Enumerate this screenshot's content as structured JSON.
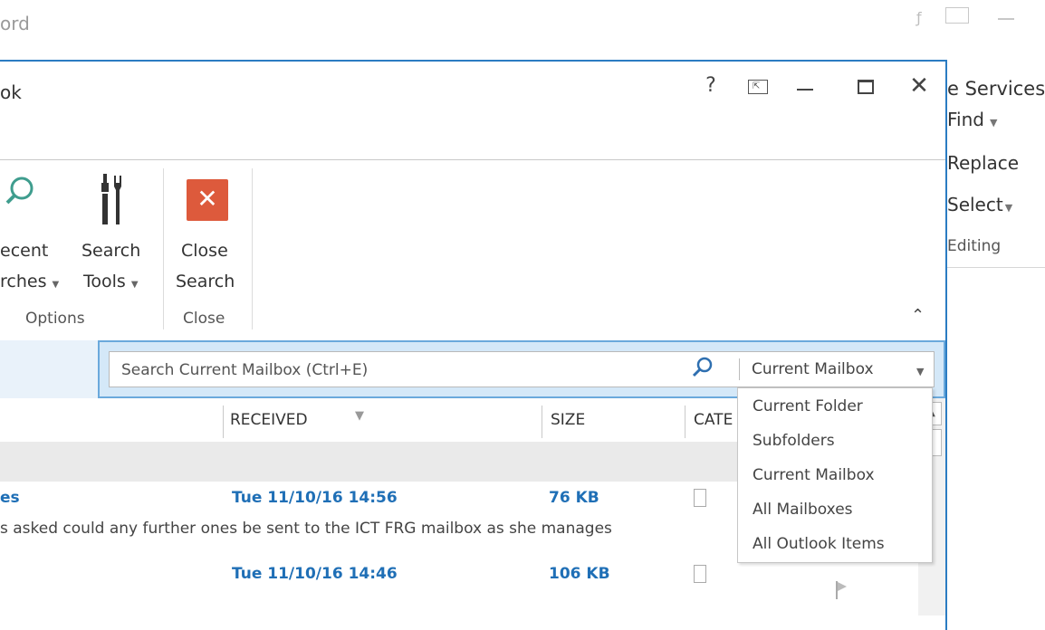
{
  "background_window": {
    "title_fragment": "ord",
    "services_fragment": "e Services",
    "editing": {
      "find": "Find",
      "replace": "Replace",
      "select": "Select",
      "group_label": "Editing"
    }
  },
  "window": {
    "title_fragment": "ok",
    "help_label": "?",
    "close_label": "✕"
  },
  "ribbon": {
    "recent_searches": {
      "line1": "ecent",
      "line2": "rches"
    },
    "search_tools": {
      "line1": "Search",
      "line2": "Tools"
    },
    "close_search": {
      "line1": "Close",
      "line2": "Search"
    },
    "groups": {
      "options": "Options",
      "close": "Close"
    }
  },
  "search": {
    "placeholder": "Search Current Mailbox (Ctrl+E)",
    "scope_selected": "Current Mailbox"
  },
  "columns": {
    "received": "RECEIVED",
    "size": "SIZE",
    "categories": "CATE"
  },
  "messages": [
    {
      "subject_fragment": "es",
      "received": "Tue 11/10/16 14:56",
      "size": "76 KB",
      "preview": "s asked could any further ones be sent to the ICT FRG mailbox as she manages"
    },
    {
      "received": "Tue 11/10/16 14:46",
      "size": "106 KB"
    }
  ],
  "scope_menu": {
    "items": [
      "Current Folder",
      "Subfolders",
      "Current Mailbox",
      "All Mailboxes",
      "All Outlook Items"
    ]
  },
  "colors": {
    "accent": "#2b7cc2",
    "link_blue": "#1f6fb6",
    "close_search_red": "#dd5a3c",
    "search_band": "#cfe5f6"
  }
}
